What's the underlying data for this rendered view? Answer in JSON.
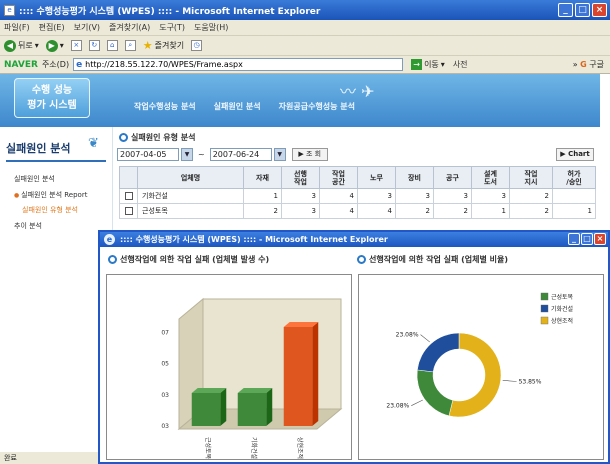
{
  "browser": {
    "title": ":::: 수행성능평가 시스템 (WPES) :::: - Microsoft Internet Explorer",
    "menu": [
      "파일(F)",
      "편집(E)",
      "보기(V)",
      "즐겨찾기(A)",
      "도구(T)",
      "도움말(H)"
    ],
    "toolbar": {
      "back": "뒤로",
      "favorites": "즐겨찾기"
    },
    "naver": "NAVER",
    "address_label": "주소(D)",
    "url": "http://218.55.122.70/WPES/Frame.aspx",
    "go": "이동",
    "dict": "사전",
    "google": "구글",
    "status": "완료"
  },
  "site": {
    "logo_lines": [
      "수행 성능",
      "평가 시스템"
    ],
    "nav": [
      "작업수행성능 분석",
      "실패원인 분석",
      "자원공급수행성능 분석"
    ]
  },
  "sidebar": {
    "title": "실패원인 분석",
    "items": [
      "실패원인 분석",
      "실패원인 분석 Report",
      "실패원인 유형 분석",
      "추이 분석"
    ]
  },
  "content": {
    "section_title": "실패원인 유형 분석",
    "date_from": "2007-04-05",
    "date_to": "2007-06-24",
    "tilde": "~",
    "query_label": "▶ 조 회",
    "chart_label": "▶ Chart",
    "columns": [
      "업체명",
      "자재",
      "선행\n작업",
      "작업\n공간",
      "노무",
      "장비",
      "공구",
      "설계\n도서",
      "작업\n지시",
      "허가\n/승인"
    ],
    "rows": [
      {
        "name": "기화건설",
        "values": [
          "1",
          "3",
          "4",
          "3",
          "3",
          "3",
          "3",
          "2"
        ]
      },
      {
        "name": "근성토목",
        "values": [
          "2",
          "3",
          "4",
          "4",
          "2",
          "2",
          "1",
          "2",
          "1"
        ]
      }
    ]
  },
  "popup": {
    "title": ":::: 수행성능평가 시스템 (WPES) :::: - Microsoft Internet Explorer",
    "left_title": "선행작업에 의한 작업 실패 (업체별 발생 수)",
    "right_title": "선행작업에 의한 작업 실패 (업체별 비율)"
  },
  "colors": {
    "green": "#3f8a3a",
    "blue": "#1f4e9c",
    "yellow": "#e3b21a",
    "orange": "#e0561f"
  },
  "chart_data": [
    {
      "type": "bar",
      "title": "선행작업에 의한 작업 실패 (업체별 발생 수)",
      "categories": [
        "근성토목",
        "기화건설",
        "상현조적"
      ],
      "values": [
        0.3,
        0.3,
        0.9
      ],
      "colors": [
        "#3f8a3a",
        "#3f8a3a",
        "#e0561f"
      ],
      "yticks": [
        "03",
        "03",
        "05",
        "07"
      ],
      "ylim": [
        0,
        1
      ],
      "xlabel": "",
      "ylabel": ""
    },
    {
      "type": "pie",
      "title": "선행작업에 의한 작업 실패 (업체별 비율)",
      "labels": [
        "근성토목",
        "기화건설",
        "상현조적"
      ],
      "values": [
        23.08,
        23.08,
        53.85
      ],
      "value_labels": [
        "23.08%",
        "23.08%",
        "53.85%"
      ],
      "colors": [
        "#3f8a3a",
        "#1f4e9c",
        "#e3b21a"
      ],
      "legend": "top-right",
      "donut": true
    }
  ]
}
